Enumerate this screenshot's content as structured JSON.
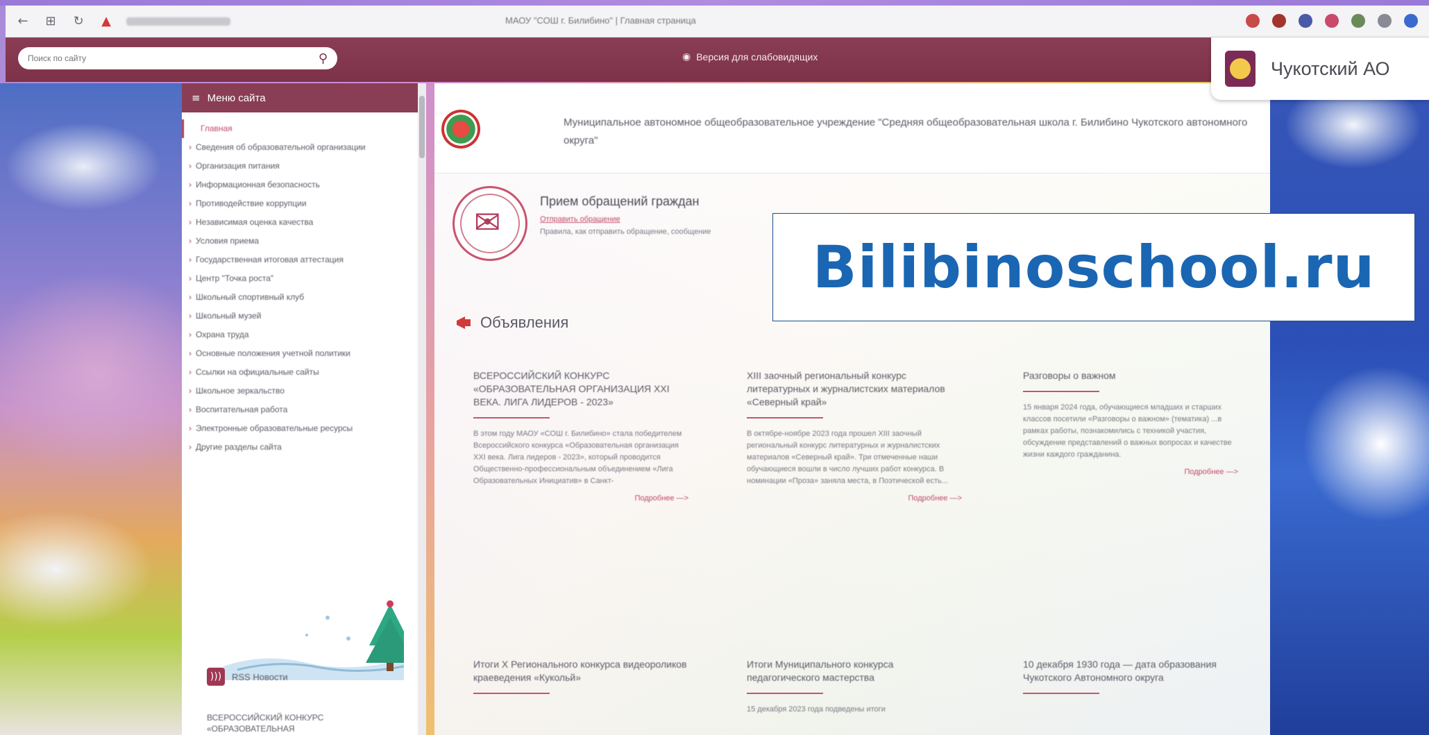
{
  "browser": {
    "tab_title": "МАОУ \"СОШ г. Билибино\" | Главная страница"
  },
  "header": {
    "search_placeholder": "Поиск по сайту",
    "vision_link": "Версия для слабовидящих",
    "region_name": "Чукотский АО"
  },
  "sidebar": {
    "menu_title": "Меню сайта",
    "items": [
      "Главная",
      "Сведения об образовательной организации",
      "Организация питания",
      "Информационная безопасность",
      "Противодействие коррупции",
      "Независимая оценка качества",
      "Условия приема",
      "Государственная итоговая аттестация",
      "Центр \"Точка роста\"",
      "Школьный спортивный клуб",
      "Школьный музей",
      "Охрана труда",
      "Основные положения учетной политики",
      "Ссылки на официальные сайты",
      "Школьное зеркальство",
      "Воспитательная работа",
      "Электронные образовательные ресурсы",
      "Другие разделы сайта"
    ],
    "rss_label": "RSS Новости",
    "rss_item": "ВСЕРОССИЙСКИЙ КОНКУРС «ОБРАЗОВАТЕЛЬНАЯ"
  },
  "main": {
    "org_name": "Муниципальное автономное общеобразовательное учреждение \"Средняя общеобразовательная школа г. Билибино Чукотского автономного округа\"",
    "appeal": {
      "title": "Прием обращений граждан",
      "link": "Отправить обращение",
      "note": "Правила, как отправить обращение, сообщение"
    },
    "announcements_title": "Объявления",
    "more_label": "Подробнее —>",
    "cards": [
      {
        "title": "ВСЕРОССИЙСКИЙ КОНКУРС «ОБРАЗОВАТЕЛЬНАЯ ОРГАНИЗАЦИЯ XXI ВЕКА. ЛИГА ЛИДЕРОВ - 2023»",
        "text": "В этом году МАОУ «СОШ г. Билибино» стала победителем Всероссийского конкурса «Образовательная организация XXI века. Лига лидеров - 2023», который проводится Общественно-профессиональным объединением «Лига Образовательных Инициатив» в Санкт-"
      },
      {
        "title": "XIII заочный региональный конкурс литературных и журналистских материалов «Северный край»",
        "text": "В октябре-ноябре 2023 года прошел XIII заочный региональный конкурс литературных и журналистских материалов «Северный край». Три отмеченные наши обучающиеся вошли в число лучших работ конкурса. В номинации «Проза» заняла места, в Поэтической есть..."
      },
      {
        "title": "Разговоры о важном",
        "text": "15 января 2024 года, обучающиеся младших и старших классов посетили «Разговоры о важном» (тематика) ...в рамках работы, познакомились с техникой участия, обсуждение представлений о важных вопросах и качестве жизни каждого гражданина."
      },
      {
        "title": "Итоги X Регионального конкурса видеороликов краеведения «Кукольй»",
        "text": ""
      },
      {
        "title": "Итоги Муниципального конкурса педагогического мастерства",
        "text": "15 декабря 2023 года подведены итоги"
      },
      {
        "title": "10 декабря 1930 года — дата образования Чукотского Автономного округа",
        "text": ""
      }
    ]
  },
  "watermark": "Bilibinoschool.ru",
  "colors": {
    "brand": "#8a3e55",
    "accent": "#c24a6a",
    "watermark_text": "#1a66b3"
  }
}
